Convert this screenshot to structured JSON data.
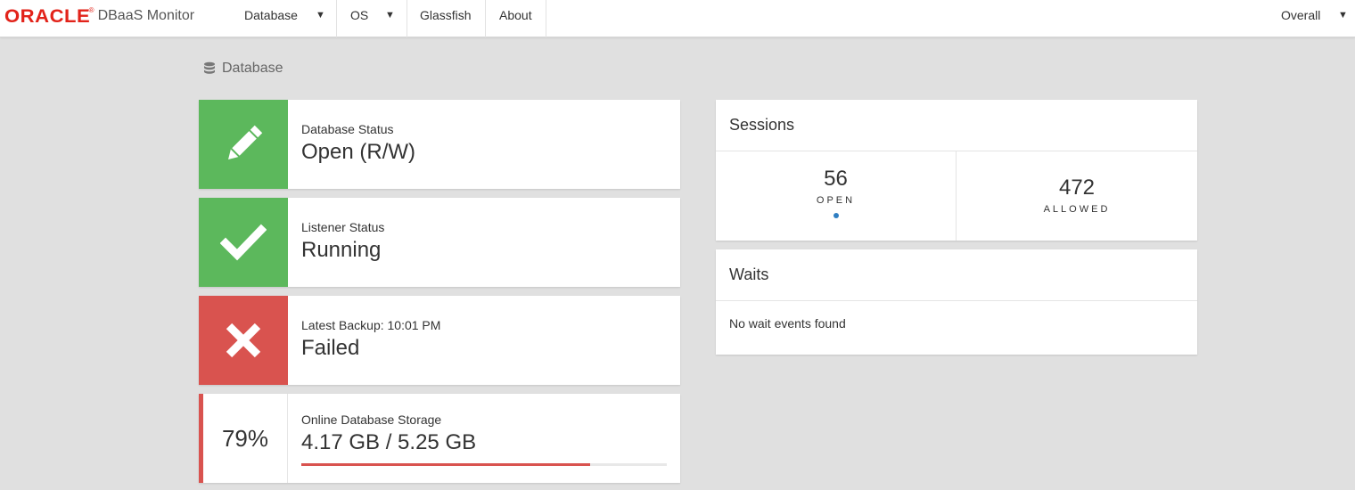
{
  "header": {
    "brand_logo": "ORACLE",
    "brand_reg": "®",
    "app_name": "DBaaS Monitor",
    "nav": [
      {
        "label": "Database",
        "caret": "▼"
      },
      {
        "label": "OS",
        "caret": "▼"
      },
      {
        "label": "Glassfish"
      },
      {
        "label": "About"
      }
    ],
    "overall": {
      "label": "Overall",
      "caret": "▼"
    }
  },
  "breadcrumb": {
    "icon": "database-icon",
    "label": "Database"
  },
  "status_cards": [
    {
      "icon": "pencil-icon",
      "color": "#5cb85c",
      "label": "Database Status",
      "value": "Open (R/W)"
    },
    {
      "icon": "check-icon",
      "color": "#5cb85c",
      "label": "Listener Status",
      "value": "Running"
    },
    {
      "icon": "close-icon",
      "color": "#d9534f",
      "label": "Latest Backup: 10:01 PM",
      "value": "Failed"
    }
  ],
  "storage": {
    "percent_label": "79%",
    "label": "Online Database Storage",
    "value": "4.17 GB / 5.25 GB",
    "fill_fraction": 0.79,
    "color": "#d9534f"
  },
  "sessions": {
    "title": "Sessions",
    "open_value": "56",
    "open_label": "OPEN",
    "allowed_value": "472",
    "allowed_label": "ALLOWED"
  },
  "waits": {
    "title": "Waits",
    "message": "No wait events found"
  },
  "colors": {
    "brand": "#e2231a",
    "success": "#5cb85c",
    "danger": "#d9534f",
    "accent": "#2f7ec2"
  }
}
